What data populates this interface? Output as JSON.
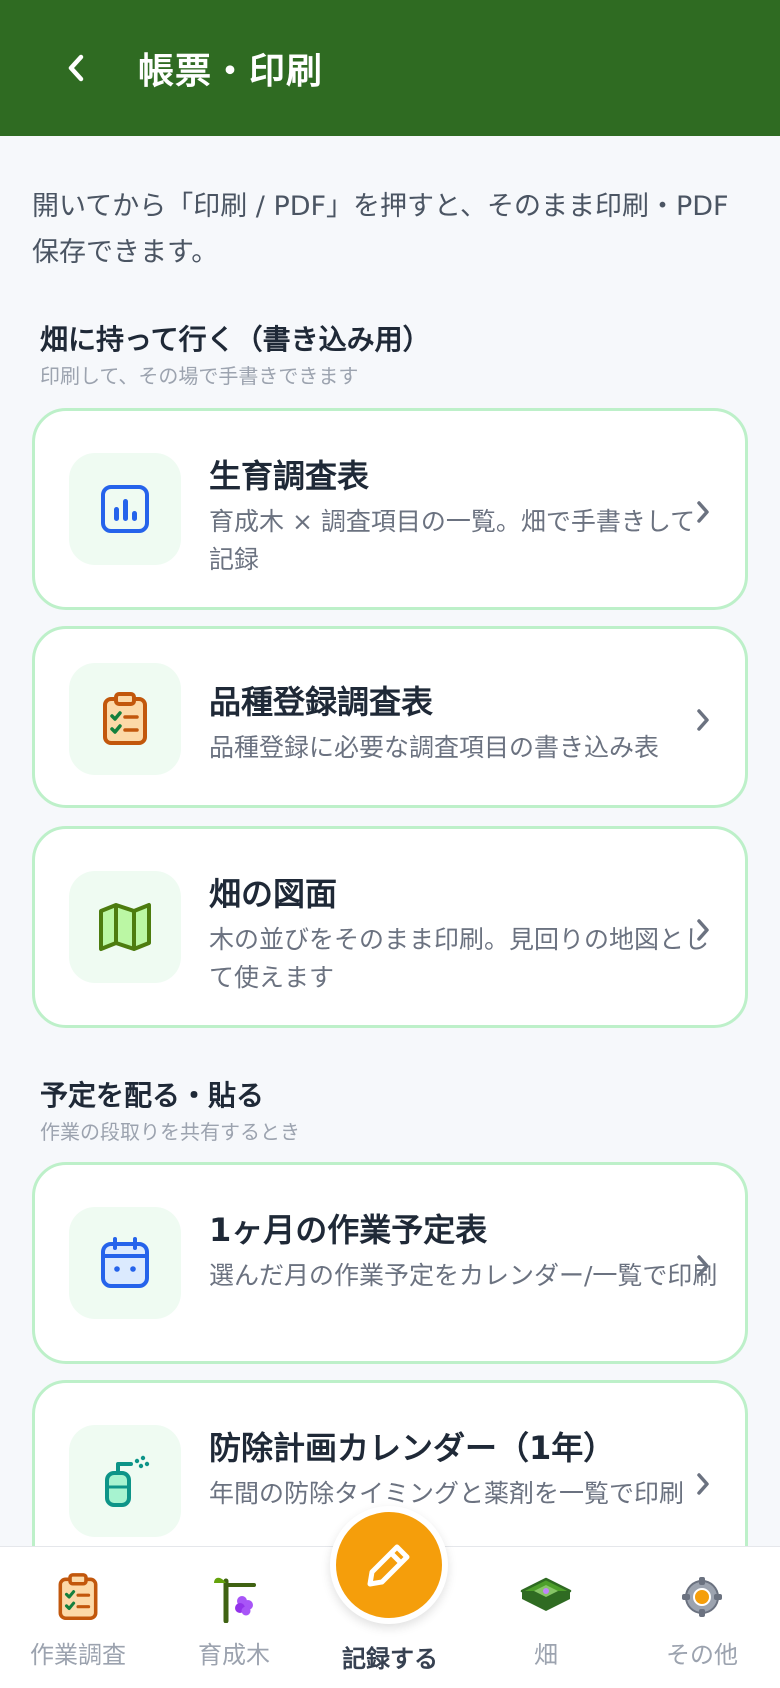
{
  "header": {
    "title": "帳票・印刷",
    "background": "#2f6b22"
  },
  "intro": "開いてから「印刷 / PDF」を押すと、そのまま印刷・PDF保存できます。",
  "sections": [
    {
      "title": "畑に持って行く（書き込み用）",
      "subtitle": "印刷して、その場で手書きできます",
      "cards": [
        {
          "title": "生育調査表",
          "description": "育成木 × 調査項目の一覧。畑で手書きして記録",
          "icon": "chart-bar-icon"
        },
        {
          "title": "品種登録調査表",
          "description": "品種登録に必要な調査項目の書き込み表",
          "icon": "clipboard-check-icon"
        },
        {
          "title": "畑の図面",
          "description": "木の並びをそのまま印刷。見回りの地図として使えます",
          "icon": "map-icon"
        }
      ]
    },
    {
      "title": "予定を配る・貼る",
      "subtitle": "作業の段取りを共有するとき",
      "cards": [
        {
          "title": "1ヶ月の作業予定表",
          "description": "選んだ月の作業予定をカレンダー/一覧で印刷",
          "icon": "calendar-icon"
        },
        {
          "title": "防除計画カレンダー（1年）",
          "description": "年間の防除タイミングと薬剤を一覧で印刷",
          "icon": "sprayer-icon"
        }
      ]
    }
  ],
  "bottom_nav": {
    "items": [
      {
        "label": "作業調査",
        "icon": "clipboard-check-icon"
      },
      {
        "label": "育成木",
        "icon": "seedling-icon"
      },
      {
        "label": "記録する",
        "icon": "pencil-icon"
      },
      {
        "label": "畑",
        "icon": "field-icon"
      },
      {
        "label": "その他",
        "icon": "gear-icon"
      }
    ],
    "fab_color": "#f59e0b"
  },
  "colors": {
    "card_border": "#bdf0c9",
    "icon_bg": "#effbf2",
    "accent_blue": "#2563eb",
    "accent_orange": "#d97706",
    "accent_green": "#4d7c0f"
  }
}
